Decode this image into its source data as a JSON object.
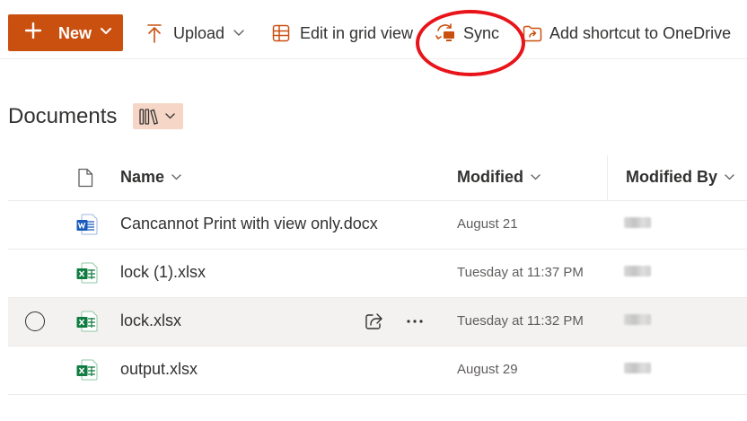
{
  "toolbar": {
    "new_label": "New",
    "upload_label": "Upload",
    "grid_label": "Edit in grid view",
    "sync_label": "Sync",
    "shortcut_label": "Add shortcut to OneDrive"
  },
  "library": {
    "title": "Documents"
  },
  "columns": {
    "name": "Name",
    "modified": "Modified",
    "modified_by": "Modified By"
  },
  "files": [
    {
      "name": "Cancannot Print with view only.docx",
      "type": "word-icon",
      "modified": "August 21"
    },
    {
      "name": "lock (1).xlsx",
      "type": "excel-icon",
      "modified": "Tuesday at 11:37 PM"
    },
    {
      "name": "lock.xlsx",
      "type": "excel-icon",
      "modified": "Tuesday at 11:32 PM"
    },
    {
      "name": "output.xlsx",
      "type": "excel-icon",
      "modified": "August 29"
    }
  ],
  "colors": {
    "accent": "#ca5010",
    "annotation": "#e8141a",
    "word": "#185abd",
    "excel": "#107c41"
  }
}
